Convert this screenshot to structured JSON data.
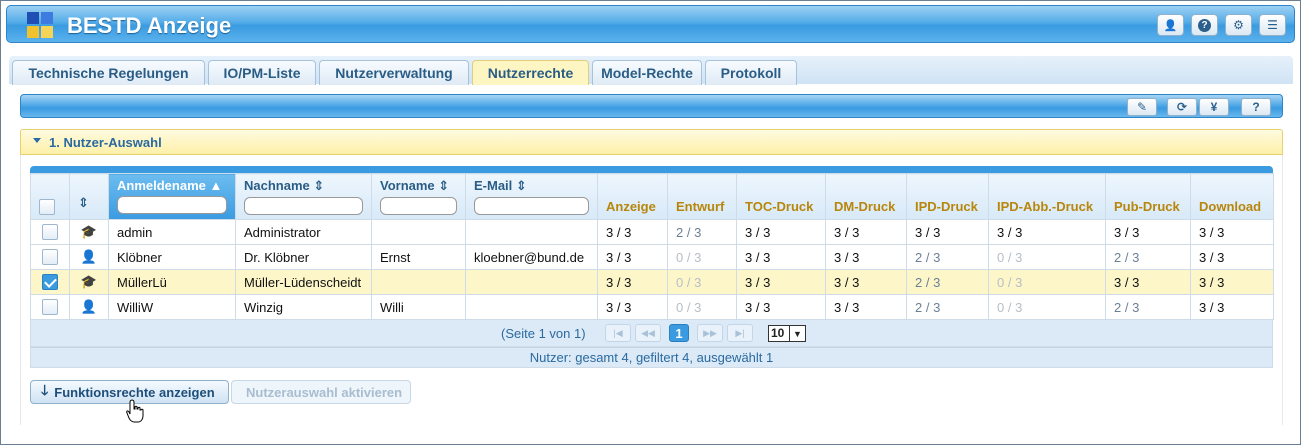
{
  "app": {
    "title": "BESTD Anzeige",
    "header_buttons": [
      {
        "icon": "user-icon",
        "glyph": "👤"
      },
      {
        "icon": "help-icon",
        "glyph": "?"
      },
      {
        "icon": "gear-icon",
        "glyph": "⚙"
      },
      {
        "icon": "menu-icon",
        "glyph": "☰"
      }
    ]
  },
  "tabs": [
    {
      "label": "Technische Regelungen",
      "active": false
    },
    {
      "label": "IO/PM-Liste",
      "active": false
    },
    {
      "label": "Nutzerverwaltung",
      "active": false
    },
    {
      "label": "Nutzerrechte",
      "active": true
    },
    {
      "label": "Model-Rechte",
      "active": false
    },
    {
      "label": "Protokoll",
      "active": false
    }
  ],
  "toolbar": {
    "buttons": [
      {
        "icon": "edit-icon",
        "glyph": "✎"
      },
      {
        "icon": "refresh-icon",
        "glyph": "⟳"
      },
      {
        "icon": "yen-icon",
        "glyph": "¥"
      },
      {
        "icon": "help-icon",
        "glyph": "?"
      }
    ]
  },
  "section": {
    "title": "1. Nutzer-Auswahl"
  },
  "table": {
    "headers": {
      "anmeldename": "Anmeldename ▲",
      "nachname": "Nachname ⇕",
      "vorname": "Vorname ⇕",
      "email": "E-Mail ⇕",
      "type_sort": "⇕",
      "perms": [
        "Anzeige",
        "Entwurf",
        "TOC-Druck",
        "DM-Druck",
        "IPD-Druck",
        "IPD-Abb.-Druck",
        "Pub-Druck",
        "Download"
      ]
    },
    "rows": [
      {
        "checked": false,
        "type_icon": "graduation-cap-icon",
        "type_glyph": "🎓",
        "anmeldename": "admin",
        "nachname": "Administrator",
        "vorname": "",
        "email": "",
        "perms": [
          "3 / 3",
          "2 / 3",
          "3 / 3",
          "3 / 3",
          "3 / 3",
          "3 / 3",
          "3 / 3",
          "3 / 3"
        ],
        "perm_state": [
          "n",
          "m",
          "n",
          "n",
          "n",
          "n",
          "n",
          "n"
        ]
      },
      {
        "checked": false,
        "type_icon": "user-icon",
        "type_glyph": "👤",
        "anmeldename": "Klöbner",
        "nachname": "Dr. Klöbner",
        "vorname": "Ernst",
        "email": "kloebner@bund.de",
        "perms": [
          "3 / 3",
          "0 / 3",
          "3 / 3",
          "3 / 3",
          "2 / 3",
          "0 / 3",
          "2 / 3",
          "3 / 3"
        ],
        "perm_state": [
          "n",
          "d",
          "n",
          "n",
          "m",
          "d",
          "m",
          "n"
        ]
      },
      {
        "checked": true,
        "type_icon": "graduation-cap-icon",
        "type_glyph": "🎓",
        "anmeldename": "MüllerLü",
        "nachname": "Müller-Lüdenscheidt",
        "vorname": "",
        "email": "",
        "perms": [
          "3 / 3",
          "0 / 3",
          "3 / 3",
          "3 / 3",
          "2 / 3",
          "0 / 3",
          "3 / 3",
          "3 / 3"
        ],
        "perm_state": [
          "n",
          "d",
          "n",
          "n",
          "m",
          "d",
          "n",
          "n"
        ]
      },
      {
        "checked": false,
        "type_icon": "user-icon",
        "type_glyph": "👤",
        "anmeldename": "WilliW",
        "nachname": "Winzig",
        "vorname": "Willi",
        "email": "",
        "perms": [
          "3 / 3",
          "0 / 3",
          "3 / 3",
          "3 / 3",
          "2 / 3",
          "0 / 3",
          "2 / 3",
          "3 / 3"
        ],
        "perm_state": [
          "n",
          "d",
          "n",
          "n",
          "m",
          "d",
          "m",
          "n"
        ]
      }
    ]
  },
  "pager": {
    "info": "(Seite 1 von 1)",
    "current_page": "1",
    "page_size": "10",
    "first": "|◀",
    "prev": "◀◀",
    "next": "▶▶",
    "last": "▶|"
  },
  "status": "Nutzer: gesamt 4, gefiltert 4, ausgewählt 1",
  "actions": {
    "show_rights": "Funktionsrechte anzeigen",
    "activate_selection": "Nutzerauswahl aktivieren"
  }
}
